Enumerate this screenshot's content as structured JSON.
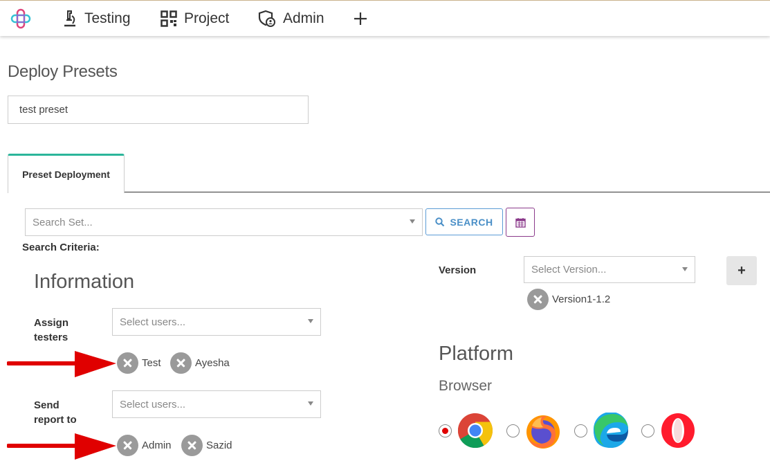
{
  "nav": {
    "items": [
      {
        "label": "Testing",
        "icon": "microscope-icon"
      },
      {
        "label": "Project",
        "icon": "qr-grid-icon"
      },
      {
        "label": "Admin",
        "icon": "admin-shield-user-icon"
      }
    ],
    "add_icon": "plus-icon"
  },
  "page": {
    "title": "Deploy Presets",
    "preset_name_value": "test preset"
  },
  "tabs": [
    {
      "label": "Preset Deployment",
      "active": true
    }
  ],
  "search": {
    "placeholder": "Search Set...",
    "button_label": "SEARCH",
    "criteria_label": "Search Criteria:"
  },
  "information": {
    "title": "Information",
    "assign_label_1": "Assign",
    "assign_label_2": "testers",
    "assign_placeholder": "Select users...",
    "testers": [
      "Test",
      "Ayesha"
    ],
    "report_label_1": "Send",
    "report_label_2": "report to",
    "report_placeholder": "Select users...",
    "report_users": [
      "Admin",
      "Sazid"
    ]
  },
  "version": {
    "label": "Version",
    "placeholder": "Select Version...",
    "selected": [
      "Version1-1.2"
    ],
    "add_label": "+"
  },
  "platform": {
    "title": "Platform",
    "browser_label": "Browser",
    "browsers": [
      {
        "name": "chrome-icon",
        "checked": true
      },
      {
        "name": "firefox-icon",
        "checked": false
      },
      {
        "name": "edge-icon",
        "checked": false
      },
      {
        "name": "opera-icon",
        "checked": false
      }
    ]
  },
  "colors": {
    "tab_accent": "#2bb59a",
    "search_button": "#4a8fc7",
    "calendar_button": "#8b3a8b",
    "annotation_arrow": "#e00000"
  }
}
